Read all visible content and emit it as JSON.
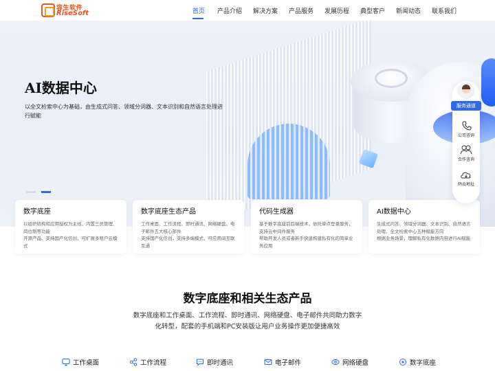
{
  "header": {
    "logo_cn": "容生软件",
    "logo_en": "RiseSoft",
    "nav": [
      {
        "label": "首页",
        "active": true
      },
      {
        "label": "产品介绍"
      },
      {
        "label": "解决方案"
      },
      {
        "label": "产品服务"
      },
      {
        "label": "发展历程"
      },
      {
        "label": "典型客户"
      },
      {
        "label": "新闻动态"
      },
      {
        "label": "联系我们"
      }
    ]
  },
  "hero": {
    "title": "AI数据中心",
    "desc": "以全文检索中心为基础，由生成式问答、领域分词器、文本识别和自然语言处理进行赋能"
  },
  "cards": [
    {
      "title": "数字底座",
      "desc": "以组织结构和应用授权为主线，内置三员管理、岗位制等功能",
      "desc2": "开源产品、支持国产化信创，可扩展多租户云模式"
    },
    {
      "title": "数字底座生态产品",
      "desc": "工作桌面、工作流程、即时通讯、网络硬盘、电子邮件五大核心部件",
      "desc2": "支持国产化信创，支持多端模式，可应用间互联互通"
    },
    {
      "title": "代码生成器",
      "desc": "基于数字底座前后端技术，依托单点登录服务，支持云中间件服务",
      "desc2": "帮助开发人员或者新手快速构建私有化的简单业务应用"
    },
    {
      "title": "AI数据中心",
      "desc": "生成式问答、领域分词器、文本识别、自然语言处理、全文检索中心五种赋能方向",
      "desc2": "根据业务场景，理解私有化数据内容进行AI赋能"
    }
  ],
  "float_panel": {
    "service": "服务通道",
    "items": [
      {
        "label": "公司咨询",
        "icon": "phone-icon"
      },
      {
        "label": "合作咨询",
        "icon": "handshake-icon"
      },
      {
        "label": "码云地址",
        "icon": "cloud-icon"
      }
    ]
  },
  "section": {
    "title": "数字底座和相关生态产品",
    "desc": "数字底座和工作桌面、工作流程、即时通讯、网络硬盘、电子邮件共同助力数字化转型，配套的手机端和PC安装版让用户业务操作更加便捷高效"
  },
  "tabs": [
    {
      "label": "工作桌面",
      "icon": "monitor-icon"
    },
    {
      "label": "工作流程",
      "icon": "flow-icon"
    },
    {
      "label": "即时通讯",
      "icon": "chat-icon"
    },
    {
      "label": "电子邮件",
      "icon": "mail-icon"
    },
    {
      "label": "网络硬盘",
      "icon": "disk-icon"
    },
    {
      "label": "数字底座",
      "icon": "base-icon"
    }
  ],
  "colors": {
    "accent": "#2f6ae6",
    "brand": "#e8531e"
  }
}
